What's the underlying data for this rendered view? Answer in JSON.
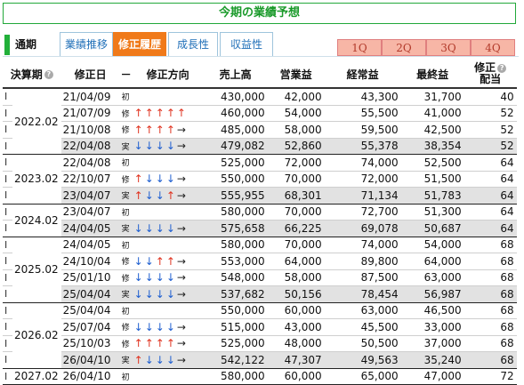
{
  "title": "今期の業績予想",
  "tabs": {
    "static_label": "通期",
    "items": [
      {
        "label": "業績推移",
        "active": false
      },
      {
        "label": "修正履歴",
        "active": true
      },
      {
        "label": "成長性",
        "active": false
      },
      {
        "label": "収益性",
        "active": false
      }
    ],
    "quarters": [
      "1Q",
      "2Q",
      "3Q",
      "4Q"
    ]
  },
  "columns": {
    "period": "決算期",
    "date": "修正日",
    "kind": "－",
    "direction": "修正方向",
    "sales": "売上高",
    "op": "営業益",
    "ordinary": "経常益",
    "net": "最終益",
    "div_line1": "修正",
    "div_line2": "配当"
  },
  "colors": {
    "up": "#e0321f",
    "down": "#1f5fd0",
    "active_tab": "#f07a1a",
    "title_green": "#1a9a2a"
  },
  "rows": [
    {
      "period": "2022.02",
      "group_start": true,
      "group_size": 4,
      "date": "21/04/09",
      "kind": "初",
      "dirs": [],
      "sales": "430,000",
      "op": "42,000",
      "ordinary": "43,300",
      "net": "31,700",
      "div": "40",
      "actual": false
    },
    {
      "date": "21/07/09",
      "kind": "修",
      "dirs": [
        "up",
        "up",
        "up",
        "up",
        "up"
      ],
      "sales": "460,000",
      "op": "54,000",
      "ordinary": "55,500",
      "net": "41,000",
      "div": "52",
      "actual": false
    },
    {
      "date": "21/10/08",
      "kind": "修",
      "dirs": [
        "up",
        "up",
        "up",
        "up",
        "flat"
      ],
      "sales": "485,000",
      "op": "58,000",
      "ordinary": "59,500",
      "net": "42,500",
      "div": "52",
      "actual": false
    },
    {
      "date": "22/04/08",
      "kind": "実",
      "dirs": [
        "down",
        "down",
        "down",
        "down",
        "flat"
      ],
      "sales": "479,082",
      "op": "52,860",
      "ordinary": "55,378",
      "net": "38,354",
      "div": "52",
      "actual": true
    },
    {
      "period": "2023.02",
      "group_start": true,
      "group_size": 3,
      "date": "22/04/08",
      "kind": "初",
      "dirs": [],
      "sales": "525,000",
      "op": "72,000",
      "ordinary": "74,000",
      "net": "52,500",
      "div": "64",
      "actual": false
    },
    {
      "date": "22/10/07",
      "kind": "修",
      "dirs": [
        "up",
        "down",
        "down",
        "down",
        "flat"
      ],
      "sales": "550,000",
      "op": "70,000",
      "ordinary": "72,000",
      "net": "51,500",
      "div": "64",
      "actual": false
    },
    {
      "date": "23/04/07",
      "kind": "実",
      "dirs": [
        "up",
        "down",
        "down",
        "up",
        "flat"
      ],
      "sales": "555,955",
      "op": "68,301",
      "ordinary": "71,134",
      "net": "51,783",
      "div": "64",
      "actual": true
    },
    {
      "period": "2024.02",
      "group_start": true,
      "group_size": 2,
      "date": "23/04/07",
      "kind": "初",
      "dirs": [],
      "sales": "580,000",
      "op": "70,000",
      "ordinary": "72,700",
      "net": "51,300",
      "div": "64",
      "actual": false
    },
    {
      "date": "24/04/05",
      "kind": "実",
      "dirs": [
        "down",
        "down",
        "down",
        "down",
        "flat"
      ],
      "sales": "575,658",
      "op": "66,225",
      "ordinary": "69,078",
      "net": "50,687",
      "div": "64",
      "actual": true
    },
    {
      "period": "2025.02",
      "group_start": true,
      "group_size": 4,
      "date": "24/04/05",
      "kind": "初",
      "dirs": [],
      "sales": "580,000",
      "op": "70,000",
      "ordinary": "74,000",
      "net": "54,000",
      "div": "68",
      "actual": false
    },
    {
      "date": "24/10/04",
      "kind": "修",
      "dirs": [
        "down",
        "down",
        "up",
        "up",
        "flat"
      ],
      "sales": "553,000",
      "op": "64,000",
      "ordinary": "89,800",
      "net": "64,000",
      "div": "68",
      "actual": false
    },
    {
      "date": "25/01/10",
      "kind": "修",
      "dirs": [
        "down",
        "down",
        "down",
        "down",
        "flat"
      ],
      "sales": "548,000",
      "op": "58,000",
      "ordinary": "87,500",
      "net": "63,000",
      "div": "68",
      "actual": false
    },
    {
      "date": "25/04/04",
      "kind": "実",
      "dirs": [
        "down",
        "down",
        "down",
        "down",
        "flat"
      ],
      "sales": "537,682",
      "op": "50,156",
      "ordinary": "78,454",
      "net": "56,987",
      "div": "68",
      "actual": true
    },
    {
      "period": "2026.02",
      "group_start": true,
      "group_size": 4,
      "date": "25/04/04",
      "kind": "初",
      "dirs": [],
      "sales": "550,000",
      "op": "60,000",
      "ordinary": "63,000",
      "net": "46,500",
      "div": "68",
      "actual": false
    },
    {
      "date": "25/07/04",
      "kind": "修",
      "dirs": [
        "down",
        "down",
        "down",
        "down",
        "flat"
      ],
      "sales": "515,000",
      "op": "43,000",
      "ordinary": "45,500",
      "net": "33,000",
      "div": "68",
      "actual": false
    },
    {
      "date": "25/10/03",
      "kind": "修",
      "dirs": [
        "up",
        "up",
        "up",
        "up",
        "flat"
      ],
      "sales": "525,000",
      "op": "48,000",
      "ordinary": "50,500",
      "net": "37,000",
      "div": "68",
      "actual": false
    },
    {
      "date": "26/04/10",
      "kind": "実",
      "dirs": [
        "up",
        "down",
        "down",
        "down",
        "flat"
      ],
      "sales": "542,122",
      "op": "47,307",
      "ordinary": "49,563",
      "net": "35,240",
      "div": "68",
      "actual": true
    },
    {
      "period": "2027.02",
      "group_start": true,
      "group_size": 1,
      "date": "26/04/10",
      "kind": "初",
      "dirs": [],
      "sales": "580,000",
      "op": "60,000",
      "ordinary": "65,000",
      "net": "47,000",
      "div": "72",
      "actual": false
    }
  ]
}
